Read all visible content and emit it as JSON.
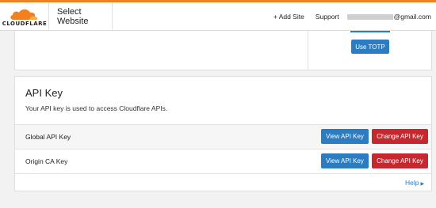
{
  "brand": {
    "logo_text": "CLOUDFLARE",
    "accent_color": "#f38020"
  },
  "header": {
    "site_select": "Select Website",
    "add_site": "+ Add Site",
    "support": "Support",
    "email_suffix": "@gmail.com"
  },
  "top_card": {
    "use_totp_label": "Use TOTP"
  },
  "api_card": {
    "title": "API Key",
    "description": "Your API key is used to access Cloudflare APIs.",
    "rows": [
      {
        "label": "Global API Key",
        "view_label": "View API Key",
        "change_label": "Change API Key"
      },
      {
        "label": "Origin CA Key",
        "view_label": "View API Key",
        "change_label": "Change API Key"
      }
    ],
    "help_label": "Help"
  },
  "colors": {
    "primary_button": "#2c7cc1",
    "danger_button": "#c5282e"
  }
}
